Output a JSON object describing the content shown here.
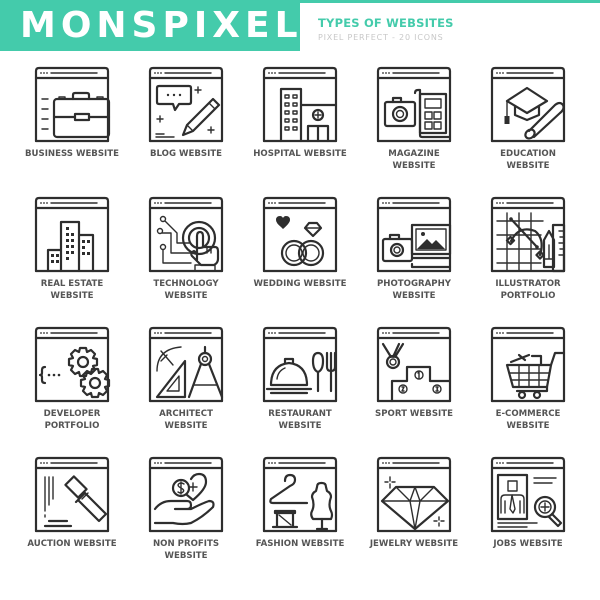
{
  "header": {
    "brand": "MONSPIXEL",
    "title": "TYPES OF WEBSITES",
    "tagline": "PIXEL PERFECT - 20 ICONS",
    "accent_color": "#44cbab"
  },
  "icons": [
    {
      "label": "BUSINESS WEBSITE",
      "icon": "briefcase-icon"
    },
    {
      "label": "BLOG WEBSITE",
      "icon": "pencil-chat-icon"
    },
    {
      "label": "HOSPITAL WEBSITE",
      "icon": "hospital-icon"
    },
    {
      "label": "MAGAZINE WEBSITE",
      "icon": "camera-layout-icon"
    },
    {
      "label": "EDUCATION WEBSITE",
      "icon": "graduation-cap-icon"
    },
    {
      "label": "REAL ESTATE WEBSITE",
      "icon": "buildings-icon"
    },
    {
      "label": "TECHNOLOGY WEBSITE",
      "icon": "touch-circuit-icon"
    },
    {
      "label": "WEDDING WEBSITE",
      "icon": "rings-icon"
    },
    {
      "label": "PHOTOGRAPHY WEBSITE",
      "icon": "camera-photo-icon"
    },
    {
      "label": "ILLUSTRATOR PORTFOLIO",
      "icon": "vector-pencil-icon"
    },
    {
      "label": "DEVELOPER PORTFOLIO",
      "icon": "gears-code-icon"
    },
    {
      "label": "ARCHITECT WEBSITE",
      "icon": "compass-ruler-icon"
    },
    {
      "label": "RESTAURANT WEBSITE",
      "icon": "cloche-cutlery-icon"
    },
    {
      "label": "SPORT WEBSITE",
      "icon": "podium-medal-icon"
    },
    {
      "label": "E-COMMERCE WEBSITE",
      "icon": "shopping-cart-icon"
    },
    {
      "label": "AUCTION WEBSITE",
      "icon": "gavel-icon"
    },
    {
      "label": "NON PROFITS WEBSITE",
      "icon": "hand-heart-icon"
    },
    {
      "label": "FASHION WEBSITE",
      "icon": "hanger-mannequin-icon"
    },
    {
      "label": "JEWELRY WEBSITE",
      "icon": "diamond-icon"
    },
    {
      "label": "JOBS WEBSITE",
      "icon": "resume-search-icon"
    }
  ]
}
